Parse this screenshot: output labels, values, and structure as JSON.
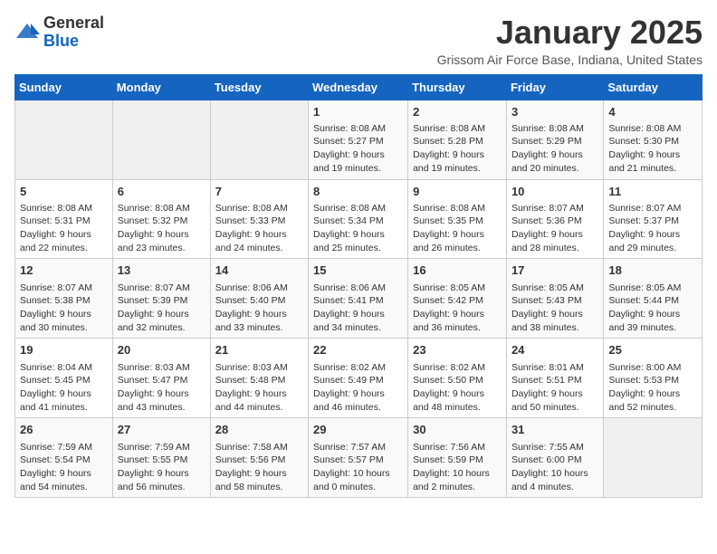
{
  "header": {
    "logo_general": "General",
    "logo_blue": "Blue",
    "title": "January 2025",
    "subtitle": "Grissom Air Force Base, Indiana, United States"
  },
  "weekdays": [
    "Sunday",
    "Monday",
    "Tuesday",
    "Wednesday",
    "Thursday",
    "Friday",
    "Saturday"
  ],
  "weeks": [
    [
      {
        "day": "",
        "empty": true
      },
      {
        "day": "",
        "empty": true
      },
      {
        "day": "",
        "empty": true
      },
      {
        "day": "1",
        "sunrise": "8:08 AM",
        "sunset": "5:27 PM",
        "daylight": "9 hours and 19 minutes."
      },
      {
        "day": "2",
        "sunrise": "8:08 AM",
        "sunset": "5:28 PM",
        "daylight": "9 hours and 19 minutes."
      },
      {
        "day": "3",
        "sunrise": "8:08 AM",
        "sunset": "5:29 PM",
        "daylight": "9 hours and 20 minutes."
      },
      {
        "day": "4",
        "sunrise": "8:08 AM",
        "sunset": "5:30 PM",
        "daylight": "9 hours and 21 minutes."
      }
    ],
    [
      {
        "day": "5",
        "sunrise": "8:08 AM",
        "sunset": "5:31 PM",
        "daylight": "9 hours and 22 minutes."
      },
      {
        "day": "6",
        "sunrise": "8:08 AM",
        "sunset": "5:32 PM",
        "daylight": "9 hours and 23 minutes."
      },
      {
        "day": "7",
        "sunrise": "8:08 AM",
        "sunset": "5:33 PM",
        "daylight": "9 hours and 24 minutes."
      },
      {
        "day": "8",
        "sunrise": "8:08 AM",
        "sunset": "5:34 PM",
        "daylight": "9 hours and 25 minutes."
      },
      {
        "day": "9",
        "sunrise": "8:08 AM",
        "sunset": "5:35 PM",
        "daylight": "9 hours and 26 minutes."
      },
      {
        "day": "10",
        "sunrise": "8:07 AM",
        "sunset": "5:36 PM",
        "daylight": "9 hours and 28 minutes."
      },
      {
        "day": "11",
        "sunrise": "8:07 AM",
        "sunset": "5:37 PM",
        "daylight": "9 hours and 29 minutes."
      }
    ],
    [
      {
        "day": "12",
        "sunrise": "8:07 AM",
        "sunset": "5:38 PM",
        "daylight": "9 hours and 30 minutes."
      },
      {
        "day": "13",
        "sunrise": "8:07 AM",
        "sunset": "5:39 PM",
        "daylight": "9 hours and 32 minutes."
      },
      {
        "day": "14",
        "sunrise": "8:06 AM",
        "sunset": "5:40 PM",
        "daylight": "9 hours and 33 minutes."
      },
      {
        "day": "15",
        "sunrise": "8:06 AM",
        "sunset": "5:41 PM",
        "daylight": "9 hours and 34 minutes."
      },
      {
        "day": "16",
        "sunrise": "8:05 AM",
        "sunset": "5:42 PM",
        "daylight": "9 hours and 36 minutes."
      },
      {
        "day": "17",
        "sunrise": "8:05 AM",
        "sunset": "5:43 PM",
        "daylight": "9 hours and 38 minutes."
      },
      {
        "day": "18",
        "sunrise": "8:05 AM",
        "sunset": "5:44 PM",
        "daylight": "9 hours and 39 minutes."
      }
    ],
    [
      {
        "day": "19",
        "sunrise": "8:04 AM",
        "sunset": "5:45 PM",
        "daylight": "9 hours and 41 minutes."
      },
      {
        "day": "20",
        "sunrise": "8:03 AM",
        "sunset": "5:47 PM",
        "daylight": "9 hours and 43 minutes."
      },
      {
        "day": "21",
        "sunrise": "8:03 AM",
        "sunset": "5:48 PM",
        "daylight": "9 hours and 44 minutes."
      },
      {
        "day": "22",
        "sunrise": "8:02 AM",
        "sunset": "5:49 PM",
        "daylight": "9 hours and 46 minutes."
      },
      {
        "day": "23",
        "sunrise": "8:02 AM",
        "sunset": "5:50 PM",
        "daylight": "9 hours and 48 minutes."
      },
      {
        "day": "24",
        "sunrise": "8:01 AM",
        "sunset": "5:51 PM",
        "daylight": "9 hours and 50 minutes."
      },
      {
        "day": "25",
        "sunrise": "8:00 AM",
        "sunset": "5:53 PM",
        "daylight": "9 hours and 52 minutes."
      }
    ],
    [
      {
        "day": "26",
        "sunrise": "7:59 AM",
        "sunset": "5:54 PM",
        "daylight": "9 hours and 54 minutes."
      },
      {
        "day": "27",
        "sunrise": "7:59 AM",
        "sunset": "5:55 PM",
        "daylight": "9 hours and 56 minutes."
      },
      {
        "day": "28",
        "sunrise": "7:58 AM",
        "sunset": "5:56 PM",
        "daylight": "9 hours and 58 minutes."
      },
      {
        "day": "29",
        "sunrise": "7:57 AM",
        "sunset": "5:57 PM",
        "daylight": "10 hours and 0 minutes."
      },
      {
        "day": "30",
        "sunrise": "7:56 AM",
        "sunset": "5:59 PM",
        "daylight": "10 hours and 2 minutes."
      },
      {
        "day": "31",
        "sunrise": "7:55 AM",
        "sunset": "6:00 PM",
        "daylight": "10 hours and 4 minutes."
      },
      {
        "day": "",
        "empty": true
      }
    ]
  ]
}
